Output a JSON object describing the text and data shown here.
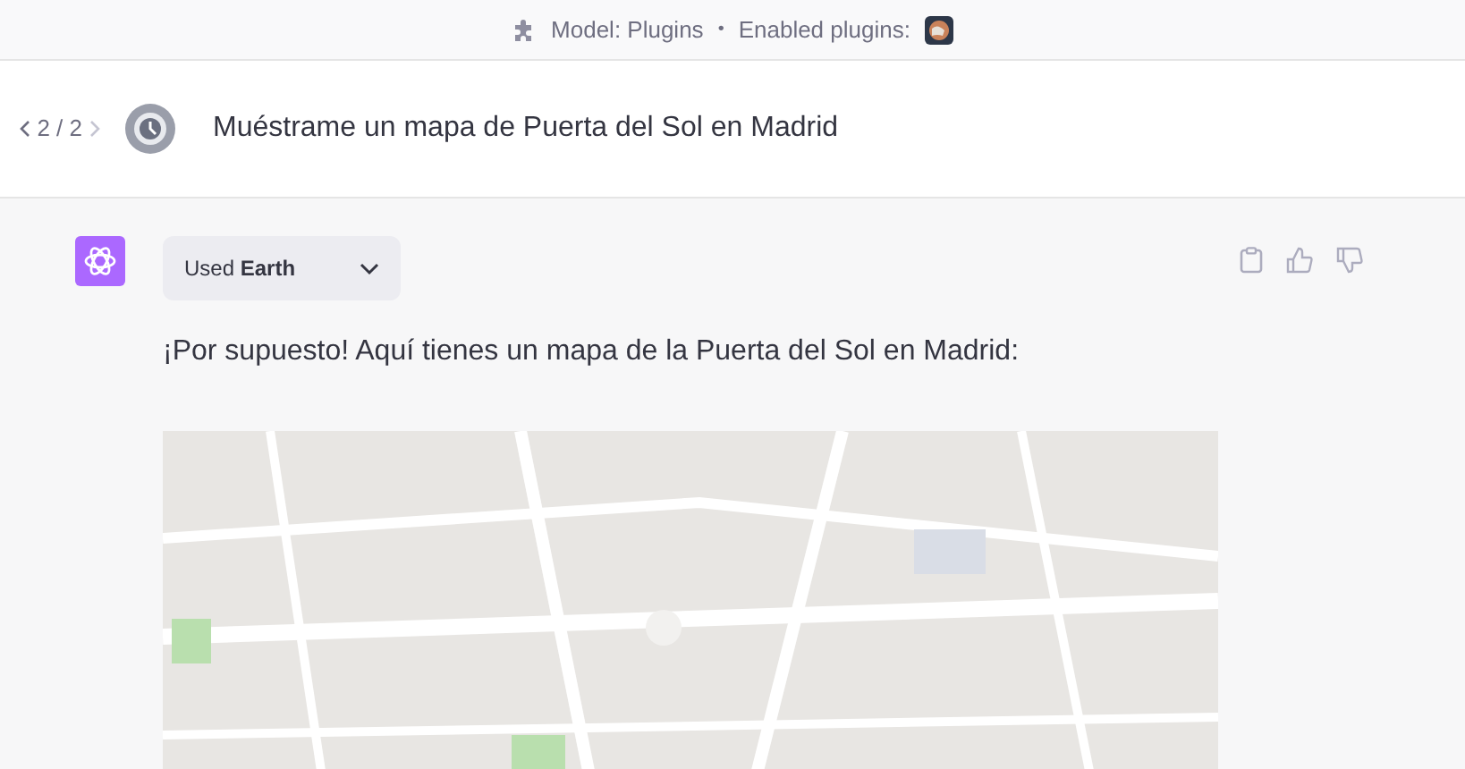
{
  "header": {
    "model_label": "Model: Plugins",
    "separator": "•",
    "plugins_label": "Enabled plugins:"
  },
  "user_message": {
    "pager": "2 / 2",
    "text": "Muéstrame un mapa de Puerta del Sol en Madrid"
  },
  "assistant_message": {
    "plugin_dropdown": {
      "label": "Used **Earth**",
      "expanded": false
    },
    "text": "¡Por supuesto! Aquí tienes un mapa de la Puerta del Sol en Madrid:"
  }
}
